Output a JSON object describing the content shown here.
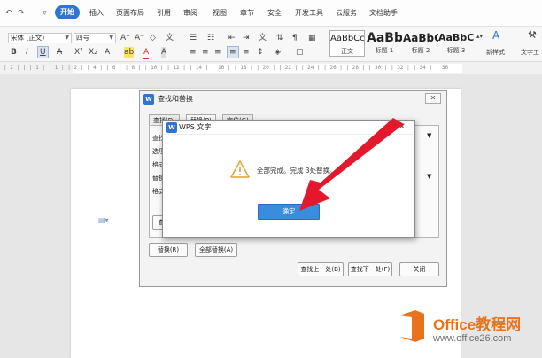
{
  "quick_access": [
    "↶",
    "↷",
    "▿"
  ],
  "tabs": [
    "开始",
    "插入",
    "页面布局",
    "引用",
    "审阅",
    "视图",
    "章节",
    "安全",
    "开发工具",
    "云服务",
    "文档助手"
  ],
  "toolbar": {
    "font_name": "宋体 (正文)",
    "font_size": "四号",
    "grow_font": "A⁺",
    "shrink_font": "A⁻",
    "clear_format": "◇",
    "pinyin": "文",
    "bold": "B",
    "italic": "I",
    "underline": "U",
    "strikethrough": "A",
    "superscript": "X²",
    "subscript": "X₂",
    "text_effect": "A",
    "highlight": "ab",
    "font_color": "A",
    "char_shading": "A",
    "styles": [
      {
        "preview": "AaBbCcI",
        "name": "正文"
      },
      {
        "preview": "AaBb",
        "name": "标题 1"
      },
      {
        "preview": "AaBbC",
        "name": "标题 2"
      },
      {
        "preview": "AaBbCc",
        "name": "标题 3"
      }
    ],
    "new_style": "新样式",
    "text_tools": "文字工"
  },
  "ruler_text": "|  2 |  |  |  1  |  |  1  |  |  2  |  |  4  |  |  6  |  |  8  |  |  10  |  |  12  |  |  14  |  |  16  |  |  18  |  |  20  |  |  22  |  |  24  |  |  26  |  |  28  |  |  30  |  |  32  |  |  34  |  |  36  |",
  "find_replace": {
    "title": "查找和替换",
    "close": "✕",
    "tabs": [
      "查找(D)",
      "替换(P)",
      "定位(G)"
    ],
    "labels": [
      "查找",
      "选项",
      "格式",
      "替换",
      "格式"
    ],
    "replace_button": "替换(R)",
    "replace_all_button": "全部替换(A)",
    "find_prev_button": "查找上一处(B)",
    "find_next_button": "查找下一处(F)",
    "close_button": "关闭",
    "side_button": "查"
  },
  "alert": {
    "title": "WPS 文字",
    "close": "✕",
    "message": "全部完成。完成 3处替换。",
    "ok_button": "确定"
  },
  "watermark": {
    "brand": "Office教程网",
    "url": "www.office26.com"
  },
  "colors": {
    "accent": "#2f74d0",
    "arrow": "#e3182c",
    "ok_button": "#3a8ddc",
    "watermark_orange": "#e8731c"
  }
}
